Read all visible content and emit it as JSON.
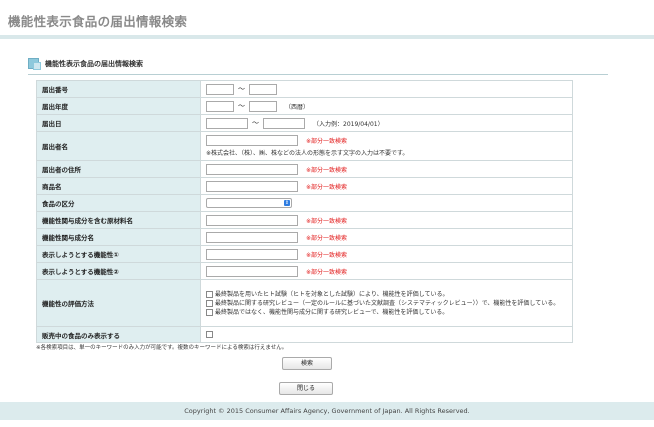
{
  "page_title": "機能性表示食品の届出情報検索",
  "section_title": "機能性表示食品の届出情報検索",
  "tilde": "〜",
  "form": {
    "notification_number": {
      "label": "届出番号"
    },
    "notification_year": {
      "label": "届出年度",
      "note": "（西暦）"
    },
    "notification_date": {
      "label": "届出日",
      "note": "（入力例：2019/04/01）"
    },
    "notifier_name": {
      "label": "届出者名",
      "partial": "※部分一致検索",
      "sub": "※株式会社、（株）、㈱、株などの法人の形態を示す文字の入力は不要です。"
    },
    "notifier_address": {
      "label": "届出者の住所",
      "partial": "※部分一致検索"
    },
    "product_name": {
      "label": "商品名",
      "partial": "※部分一致検索"
    },
    "food_category": {
      "label": "食品の区分"
    },
    "ingredient_raw_material": {
      "label": "機能性関与成分を含む原材料名",
      "partial": "※部分一致検索"
    },
    "functional_ingredient": {
      "label": "機能性関与成分名",
      "partial": "※部分一致検索"
    },
    "claimed_function_1": {
      "label": "表示しようとする機能性①",
      "partial": "※部分一致検索"
    },
    "claimed_function_2": {
      "label": "表示しようとする機能性②",
      "partial": "※部分一致検索"
    },
    "evaluation_method": {
      "label": "機能性の評価方法",
      "options": [
        "最終製品を用いたヒト試験（ヒトを対象とした試験）により、機能性を評価している。",
        "最終製品に関する研究レビュー（一定のルールに基づいた文献調査（システマティックレビュー））で、機能性を評価している。",
        "最終製品ではなく、機能性関与成分に関する研究レビューで、機能性を評価している。"
      ]
    },
    "on_sale_only": {
      "label": "販売中の食品のみ表示する"
    }
  },
  "footnote": "※各検索項目は、単一のキーワードのみ入力が可能です。複数のキーワードによる検索は行えません。",
  "search_button": "検索",
  "close_button": "閉じる",
  "footer_text": "Copyright © 2015 Consumer Affairs Agency, Government of Japan. All Rights Reserved."
}
